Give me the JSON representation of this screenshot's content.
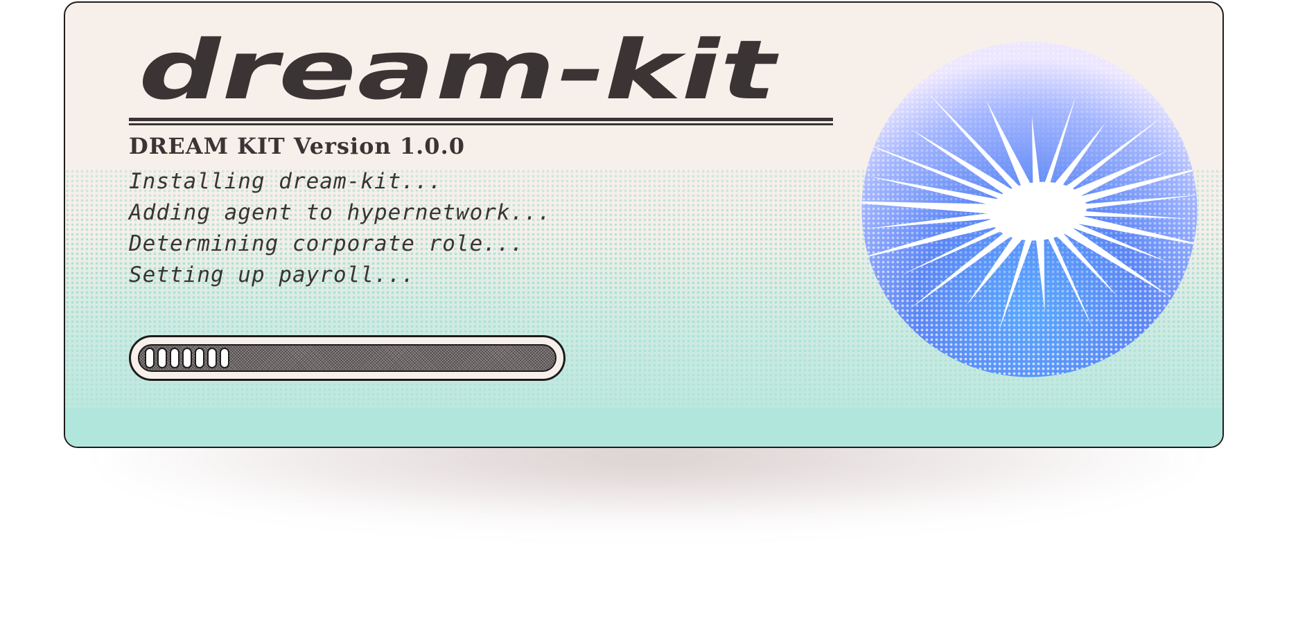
{
  "app": {
    "logo_text": "dream-kit",
    "version_title": "DREAM KIT Version 1.0.0"
  },
  "log_lines": [
    "Installing dream-kit...",
    "Adding agent to hypernetwork...",
    "Determining corporate role...",
    "Setting up payroll..."
  ],
  "progress": {
    "filled_segments": 7,
    "fraction": 0.21
  },
  "icons": {
    "orb": "starburst-orb-icon"
  },
  "colors": {
    "ink": "#3a3434",
    "panel_bg": "#f7efe9",
    "teal": "#b1e6dd",
    "orb_blue": "#5aa8ff",
    "orb_lavender": "#ece6ff"
  }
}
